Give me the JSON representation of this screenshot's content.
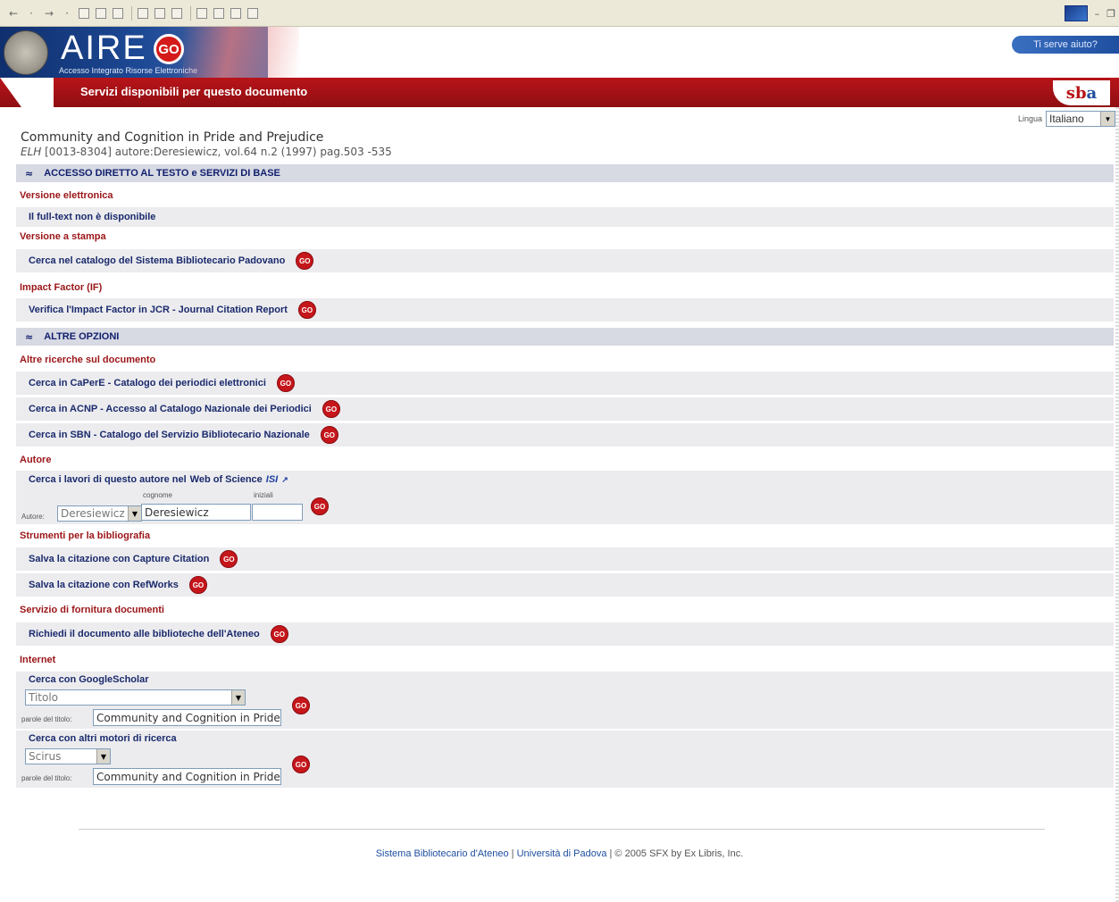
{
  "header": {
    "aire": "AIRE",
    "go": "GO",
    "subtitle": "Accesso Integrato Risorse Elettroniche",
    "help": "Ti serve aiuto?",
    "bar_title": "Servizi disponibili per questo documento",
    "sba_s": "s",
    "sba_b": "b",
    "sba_a": "a"
  },
  "language": {
    "label": "Lingua",
    "value": "Italiano"
  },
  "document": {
    "title": "Community and Cognition in Pride and Prejudice",
    "journal": "ELH",
    "meta": "[0013-8304] autore:Deresiewicz, vol.64 n.2 (1997) pag.503 -535"
  },
  "sections": {
    "direct": "ACCESSO DIRETTO AL TESTO e SERVIZI DI BASE",
    "other": "ALTRE OPZIONI"
  },
  "categories": {
    "electronic": "Versione elettronica",
    "print": "Versione a stampa",
    "impact": "Impact Factor (IF)",
    "other_searches": "Altre ricerche sul documento",
    "author": "Autore",
    "biblio": "Strumenti per la bibliografia",
    "delivery": "Servizio di fornitura documenti",
    "internet": "Internet"
  },
  "services": {
    "fulltext": "Il full-text non è disponibile",
    "catalog_padova": "Cerca nel catalogo del Sistema Bibliotecario Padovano",
    "jcr": "Verifica l'Impact Factor in JCR - Journal Citation Report",
    "caperE": "Cerca in CaPerE - Catalogo dei periodici elettronici",
    "acnp": "Cerca in ACNP - Accesso al Catalogo Nazionale dei Periodici",
    "sbn": "Cerca in SBN - Catalogo del Servizio Bibliotecario Nazionale",
    "wos_prefix": "Cerca i lavori di questo autore nel",
    "wos_link": "Web of Science",
    "isi": "ISI",
    "capture": "Salva la citazione con Capture Citation",
    "refworks": "Salva la citazione con RefWorks",
    "ateneo": "Richiedi il documento alle biblioteche dell'Ateneo",
    "google": "Cerca con GoogleScholar",
    "others": "Cerca con altri motori di ricerca"
  },
  "author_form": {
    "label": "Autore:",
    "select": "Deresiewicz",
    "cognome_label": "cognome",
    "cognome": "Deresiewicz",
    "iniziali_label": "iniziali",
    "iniziali": ""
  },
  "google_form": {
    "select": "Titolo",
    "label": "parole del titolo:",
    "value": "Community and Cognition in Pride an"
  },
  "other_form": {
    "select": "Scirus",
    "label": "parole del titolo:",
    "value": "Community and Cognition in Pride an"
  },
  "go_label": "GO",
  "footer": {
    "link1": "Sistema Bibliotecario d'Ateneo",
    "sep1": " | ",
    "link2": "Università di Padova",
    "rest": " | © 2005 SFX by Ex Libris, Inc."
  },
  "colors": {
    "red_bar": "#b81419",
    "section_bg": "#d7d9e3",
    "row_bg": "#ececef",
    "category": "#9b1518",
    "link": "#1a2a6c"
  }
}
